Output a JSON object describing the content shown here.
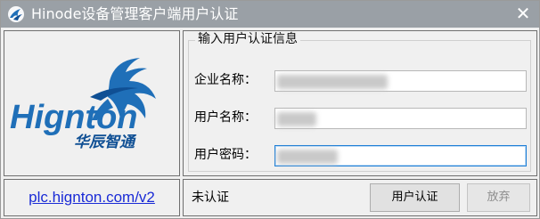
{
  "window": {
    "title": "Hinode设备管理客户端用户认证",
    "close_glyph": "✕"
  },
  "logo": {
    "brand_text": "Hignton",
    "chinese_text": "华辰智通",
    "colors": {
      "blue": "#1f6fb8",
      "dark_blue": "#0f4f94"
    }
  },
  "link": {
    "text": "plc.hignton.com/v2",
    "color": "#1a2bd6"
  },
  "form": {
    "group_title": "输入用户认证信息",
    "fields": [
      {
        "label": "企业名称：",
        "value": ""
      },
      {
        "label": "用户名称：",
        "value": ""
      },
      {
        "label": "用户密码：",
        "value": ""
      }
    ]
  },
  "status": {
    "text": "未认证"
  },
  "buttons": {
    "auth_label": "用户认证",
    "cancel_label": "放弃"
  },
  "colors": {
    "titlebar": "#9aa0a6",
    "focus_border": "#1f7fd6"
  }
}
